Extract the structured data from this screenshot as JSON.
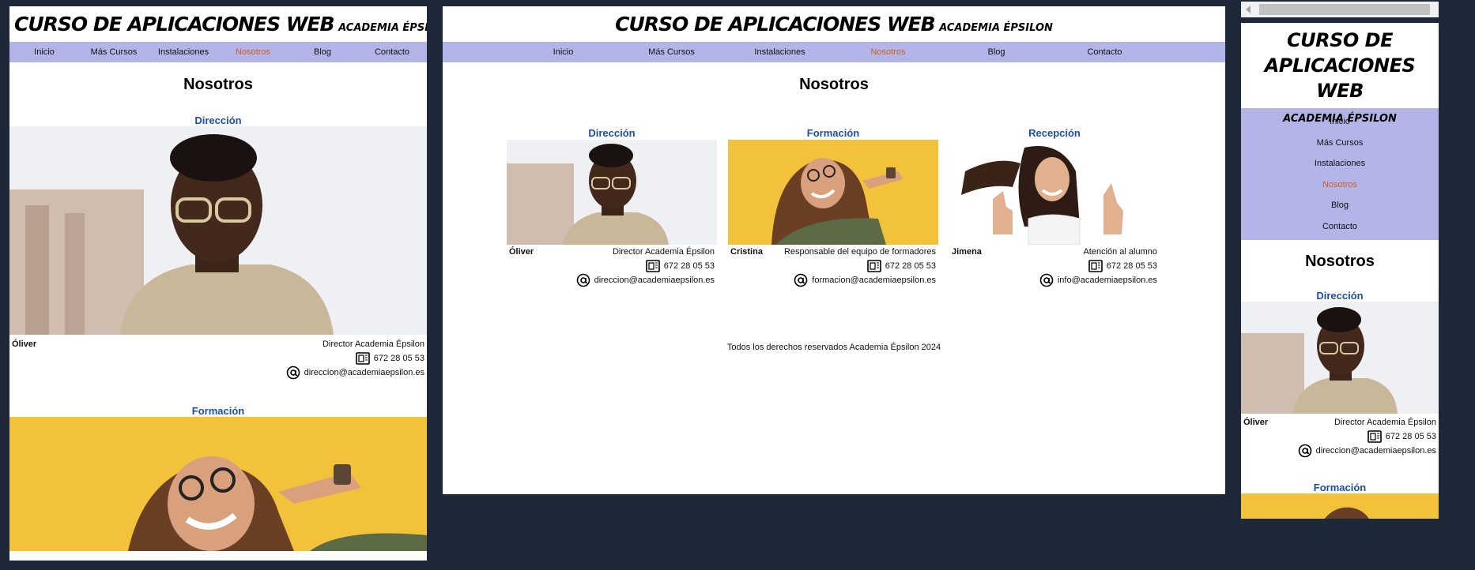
{
  "site": {
    "title": "CURSO DE APLICACIONES WEB",
    "subtitle": "ACADEMIA ÉPSILON"
  },
  "nav": {
    "items": [
      "Inicio",
      "Más Cursos",
      "Instalaciones",
      "Nosotros",
      "Blog",
      "Contacto"
    ],
    "active": "Nosotros",
    "active_color": "#d35a1c",
    "background": "#b3b5e9"
  },
  "page": {
    "heading": "Nosotros"
  },
  "team": [
    {
      "section": "Dirección",
      "name": "Óliver",
      "role": "Director Academia Épsilon",
      "phone": "672 28 05 53",
      "email": "direccion@academiaepsilon.es"
    },
    {
      "section": "Formación",
      "name": "Cristina",
      "role": "Responsable del equipo de formadores",
      "phone": "672 28 05 53",
      "email": "formacion@academiaepsilon.es"
    },
    {
      "section": "Recepción",
      "name": "Jimena",
      "role": "Atención al alumno",
      "phone": "672 28 05 53",
      "email": "info@academiaepsilon.es"
    }
  ],
  "footer": {
    "text": "Todos los derechos reservados Academia Épsilon 2024"
  },
  "colors": {
    "section_title": "#1d4fa3",
    "background": "#1e2839"
  }
}
